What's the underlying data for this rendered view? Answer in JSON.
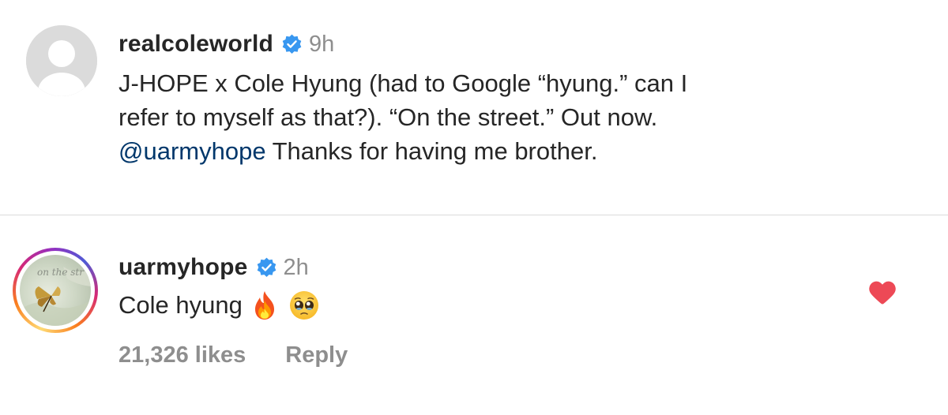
{
  "caption": {
    "username": "realcoleworld",
    "time": "9h",
    "text_part1": "J-HOPE x Cole Hyung (had to Google “hyung.” can I\nrefer to myself as that?). “On the street.” Out now.\n",
    "mention": "@uarmyhope",
    "text_part2": "  Thanks for having me brother."
  },
  "reply": {
    "username": "uarmyhope",
    "time": "2h",
    "text": "Cole hyung",
    "emojis": [
      "fire-emoji",
      "pleading-face-emoji"
    ],
    "avatar_text": "on the str",
    "likes": "21,326 likes",
    "reply_label": "Reply",
    "liked": true
  },
  "colors": {
    "verified": "#3897f0",
    "heart": "#ed4956",
    "mention": "#00376b",
    "secondary_text": "#8e8e8e"
  },
  "icons": {
    "verified": "verified-badge-icon",
    "like": "heart-filled-icon",
    "default_avatar": "default-avatar-icon"
  }
}
